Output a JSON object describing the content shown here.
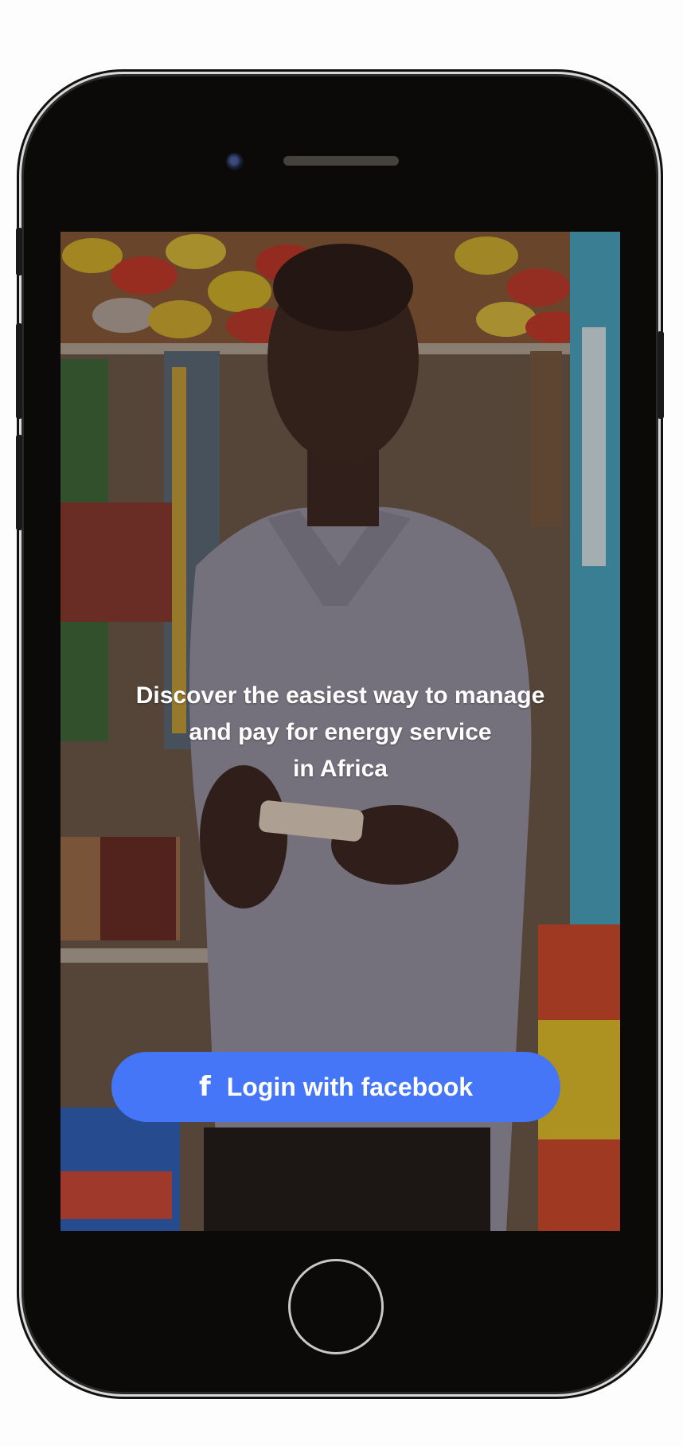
{
  "screen": {
    "tagline_lines": [
      "Discover the easiest way to manage",
      "and pay for energy service",
      "in Africa"
    ],
    "login_button": {
      "icon": "facebook-icon",
      "icon_glyph": "f",
      "label": "Login with facebook"
    }
  },
  "colors": {
    "button_background": "#4576f7",
    "text": "#ffffff",
    "device_body": "#0b0a08"
  }
}
